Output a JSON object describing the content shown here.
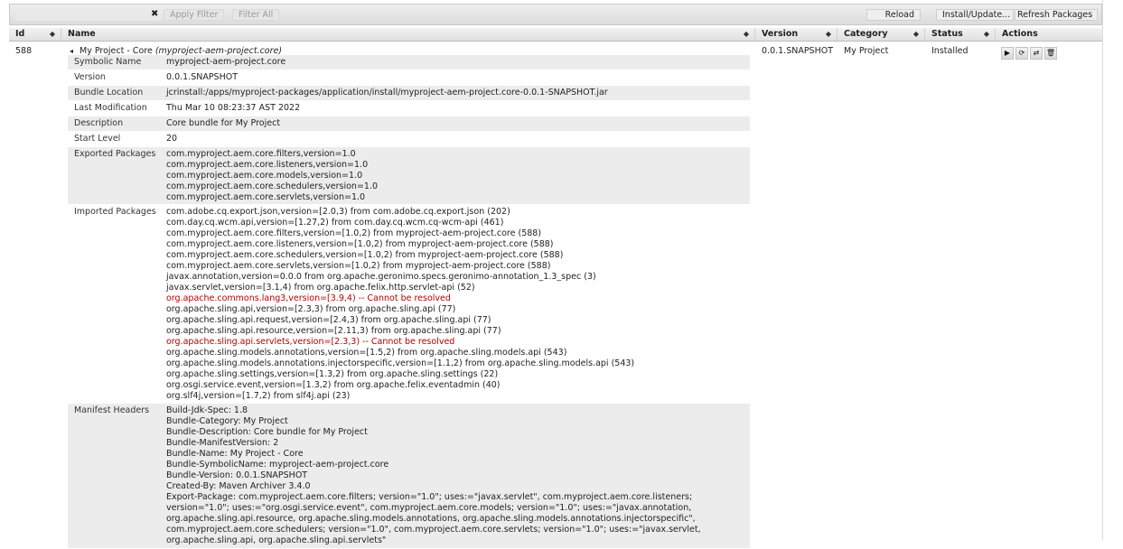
{
  "toolbar": {
    "clear_icon": "✖",
    "apply_filter": "Apply Filter",
    "filter_all": "Filter All",
    "reload": "Reload",
    "install_update": "Install/Update...",
    "refresh_packages": "Refresh Packages"
  },
  "columns": {
    "id": "Id",
    "name": "Name",
    "version": "Version",
    "category": "Category",
    "status": "Status",
    "actions": "Actions",
    "sort_glyph": "◆"
  },
  "bundle": {
    "id": "588",
    "expander": "◂",
    "name": "My Project - Core",
    "symbolic_paren": "(myproject-aem-project.core)",
    "version": "0.0.1.SNAPSHOT",
    "category": "My Project",
    "status": "Installed"
  },
  "action_icons": [
    "play-icon",
    "refresh-icon",
    "update-icon",
    "trash-icon"
  ],
  "action_glyphs": [
    "▶",
    "⟳",
    "⇄",
    "🗑"
  ],
  "details": {
    "symbolic_name": {
      "key": "Symbolic Name",
      "value": "myproject-aem-project.core"
    },
    "version": {
      "key": "Version",
      "value": "0.0.1.SNAPSHOT"
    },
    "bundle_location": {
      "key": "Bundle Location",
      "value": "jcrinstall:/apps/myproject-packages/application/install/myproject-aem-project.core-0.0.1-SNAPSHOT.jar"
    },
    "last_modification": {
      "key": "Last Modification",
      "value": "Thu Mar 10 08:23:37 AST 2022"
    },
    "description": {
      "key": "Description",
      "value": "Core bundle for My Project"
    },
    "start_level": {
      "key": "Start Level",
      "value": "20"
    },
    "exported_packages": {
      "key": "Exported Packages",
      "lines": [
        "com.myproject.aem.core.filters,version=1.0",
        "com.myproject.aem.core.listeners,version=1.0",
        "com.myproject.aem.core.models,version=1.0",
        "com.myproject.aem.core.schedulers,version=1.0",
        "com.myproject.aem.core.servlets,version=1.0"
      ]
    },
    "imported_packages": {
      "key": "Imported Packages",
      "lines": [
        {
          "text": "com.adobe.cq.export.json,version=[2.0,3) from com.adobe.cq.export.json (202)",
          "error": false
        },
        {
          "text": "com.day.cq.wcm.api,version=[1.27,2) from com.day.cq.wcm.cq-wcm-api (461)",
          "error": false
        },
        {
          "text": "com.myproject.aem.core.filters,version=[1.0,2) from myproject-aem-project.core (588)",
          "error": false
        },
        {
          "text": "com.myproject.aem.core.listeners,version=[1.0,2) from myproject-aem-project.core (588)",
          "error": false
        },
        {
          "text": "com.myproject.aem.core.schedulers,version=[1.0,2) from myproject-aem-project.core (588)",
          "error": false
        },
        {
          "text": "com.myproject.aem.core.servlets,version=[1.0,2) from myproject-aem-project.core (588)",
          "error": false
        },
        {
          "text": "javax.annotation,version=0.0.0 from org.apache.geronimo.specs.geronimo-annotation_1.3_spec (3)",
          "error": false
        },
        {
          "text": "javax.servlet,version=[3.1,4) from org.apache.felix.http.servlet-api (52)",
          "error": false
        },
        {
          "text": "org.apache.commons.lang3,version=[3.9,4) -- Cannot be resolved",
          "error": true
        },
        {
          "text": "org.apache.sling.api,version=[2.3,3) from org.apache.sling.api (77)",
          "error": false
        },
        {
          "text": "org.apache.sling.api.request,version=[2.4,3) from org.apache.sling.api (77)",
          "error": false
        },
        {
          "text": "org.apache.sling.api.resource,version=[2.11,3) from org.apache.sling.api (77)",
          "error": false
        },
        {
          "text": "org.apache.sling.api.servlets,version=[2.3,3) -- Cannot be resolved",
          "error": true
        },
        {
          "text": "org.apache.sling.models.annotations,version=[1.5,2) from org.apache.sling.models.api (543)",
          "error": false
        },
        {
          "text": "org.apache.sling.models.annotations.injectorspecific,version=[1.1,2) from org.apache.sling.models.api (543)",
          "error": false
        },
        {
          "text": "org.apache.sling.settings,version=[1.3,2) from org.apache.sling.settings (22)",
          "error": false
        },
        {
          "text": "org.osgi.service.event,version=[1.3,2) from org.apache.felix.eventadmin (40)",
          "error": false
        },
        {
          "text": "org.slf4j,version=[1.7,2) from slf4j.api (23)",
          "error": false
        }
      ]
    },
    "manifest_headers": {
      "key": "Manifest Headers",
      "lines": [
        "Build-Jdk-Spec: 1.8",
        "Bundle-Category: My Project",
        "Bundle-Description: Core bundle for My Project",
        "Bundle-ManifestVersion: 2",
        "Bundle-Name: My Project - Core",
        "Bundle-SymbolicName: myproject-aem-project.core",
        "Bundle-Version: 0.0.1.SNAPSHOT",
        "Created-By: Maven Archiver 3.4.0",
        "Export-Package: com.myproject.aem.core.filters; version=\"1.0\"; uses:=\"javax.servlet\", com.myproject.aem.core.listeners;",
        "version=\"1.0\"; uses:=\"org.osgi.service.event\", com.myproject.aem.core.models; version=\"1.0\"; uses:=\"javax.annotation,",
        "org.apache.sling.api.resource, org.apache.sling.models.annotations, org.apache.sling.models.annotations.injectorspecific\",",
        "com.myproject.aem.core.schedulers; version=\"1.0\", com.myproject.aem.core.servlets; version=\"1.0\"; uses:=\"javax.servlet,",
        "org.apache.sling.api, org.apache.sling.api.servlets\""
      ]
    }
  }
}
